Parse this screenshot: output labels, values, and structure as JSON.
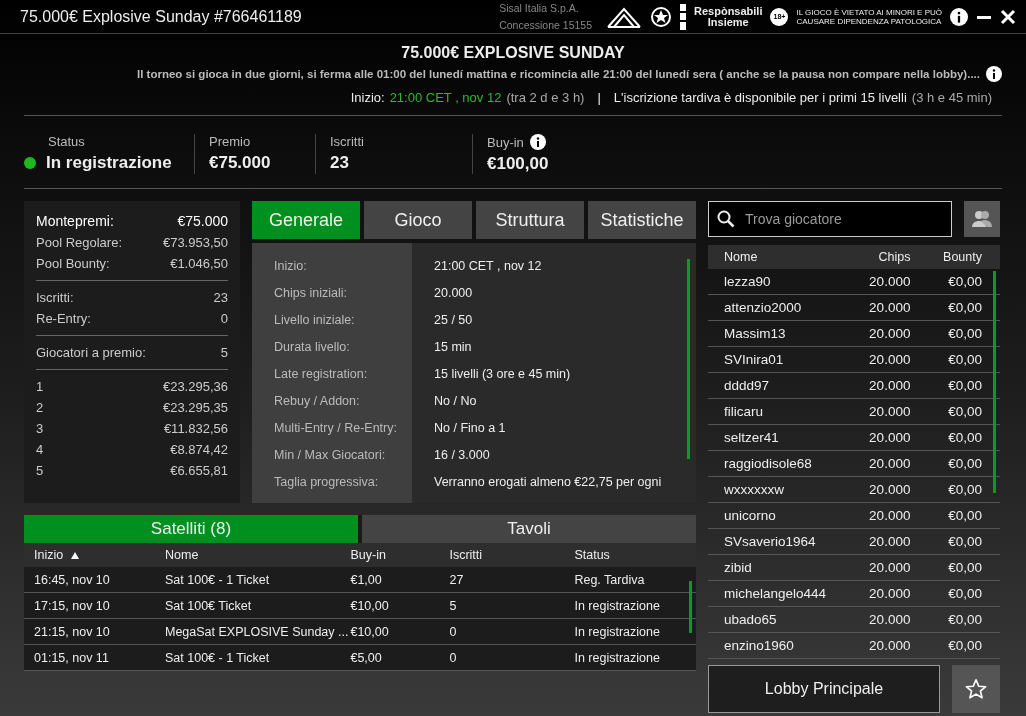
{
  "window": {
    "title": "75.000€ Explosive Sunday #766461189"
  },
  "header_logos": {
    "company": "Sisal Italia S.p.A.",
    "license": "Concessione 15155",
    "responsible": [
      "Respònsabili",
      "Insieme"
    ],
    "age_badge": "18+",
    "warning": [
      "IL GIOCO È VIETATO AI MINORI E PUÒ",
      "CAUSARE DIPENDENZA PATOLOGICA"
    ]
  },
  "tournament": {
    "name": "75.000€ EXPLOSIVE SUNDAY",
    "note": "Il torneo si gioca in due giorni, si ferma alle 01:00 del lunedí mattina e ricomincia alle 21:00 del lunedí sera ( anche se la pausa non compare nella lobby)....",
    "start_label": "Inizio:",
    "start_time": "21:00 CET , nov 12",
    "start_countdown": "(tra 2 d e 3 h)",
    "separator": "|",
    "late_reg": "L'iscrizione tardiva è disponibile per i primi 15 livelli",
    "late_reg_time": "(3 h e 45 min)"
  },
  "stats": [
    {
      "kind": "status",
      "label": "Status",
      "value": "In registrazione",
      "color": "#1db81d"
    },
    {
      "kind": "plain",
      "label": "Premio",
      "value": "€75.000"
    },
    {
      "kind": "plain",
      "label": "Iscritti",
      "value": "23"
    },
    {
      "kind": "info",
      "label": "Buy-in",
      "value": "€100,00"
    }
  ],
  "prize_summary": {
    "groups": [
      [
        {
          "label": "Montepremi:",
          "value": "€75.000"
        },
        {
          "label": "Pool Regolare:",
          "value": "€73.953,50"
        },
        {
          "label": "Pool Bounty:",
          "value": "€1.046,50"
        }
      ],
      [
        {
          "label": "Iscritti:",
          "value": "23"
        },
        {
          "label": "Re-Entry:",
          "value": "0"
        }
      ],
      [
        {
          "label": "Giocatori a premio:",
          "value": "5"
        }
      ],
      [
        {
          "label": "1",
          "value": "€23.295,36"
        },
        {
          "label": "2",
          "value": "€23.295,35"
        },
        {
          "label": "3",
          "value": "€11.832,56"
        },
        {
          "label": "4",
          "value": "€8.874,42"
        },
        {
          "label": "5",
          "value": "€6.655,81"
        }
      ]
    ]
  },
  "detail_tabs": [
    {
      "label": "Generale",
      "selected": true
    },
    {
      "label": "Gioco",
      "selected": false
    },
    {
      "label": "Struttura",
      "selected": false
    },
    {
      "label": "Statistiche",
      "selected": false
    }
  ],
  "details": [
    {
      "label": "Inizio:",
      "value": "21:00 CET , nov 12"
    },
    {
      "label": "Chips iniziali:",
      "value": "20.000"
    },
    {
      "label": "Livello iniziale:",
      "value": "25 / 50"
    },
    {
      "label": "Durata livello:",
      "value": "15 min"
    },
    {
      "label": "Late registration:",
      "value": "15 livelli (3 ore e 45 min)"
    },
    {
      "label": "Rebuy / Addon:",
      "value": "No / No"
    },
    {
      "label": "Multi-Entry / Re-Entry:",
      "value": "No / Fino a 1"
    },
    {
      "label": "Min / Max Giocatori:",
      "value": "16 / 3.000"
    },
    {
      "label": "Taglia progressiva:",
      "value": "Verranno erogati almeno €22,75 per ogni"
    }
  ],
  "players": {
    "search_placeholder": "Trova giocatore",
    "columns": [
      "Nome",
      "Chips",
      "Bounty"
    ],
    "rows": [
      [
        "lezza90",
        "20.000",
        "€0,00"
      ],
      [
        "attenzio2000",
        "20.000",
        "€0,00"
      ],
      [
        "Massim13",
        "20.000",
        "€0,00"
      ],
      [
        "SVInira01",
        "20.000",
        "€0,00"
      ],
      [
        "dddd97",
        "20.000",
        "€0,00"
      ],
      [
        "filicaru",
        "20.000",
        "€0,00"
      ],
      [
        "seltzer41",
        "20.000",
        "€0,00"
      ],
      [
        "raggiodisole68",
        "20.000",
        "€0,00"
      ],
      [
        "wxxxxxxw",
        "20.000",
        "€0,00"
      ],
      [
        "unicorno",
        "20.000",
        "€0,00"
      ],
      [
        "SVsaverio1964",
        "20.000",
        "€0,00"
      ],
      [
        "zibid",
        "20.000",
        "€0,00"
      ],
      [
        "michelangelo444",
        "20.000",
        "€0,00"
      ],
      [
        "ubado65",
        "20.000",
        "€0,00"
      ],
      [
        "enzino1960",
        "20.000",
        "€0,00"
      ]
    ]
  },
  "satellite_tabs": [
    {
      "label": "Satelliti (8)",
      "selected": true
    },
    {
      "label": "Tavoli",
      "selected": false
    }
  ],
  "satellites": {
    "columns": [
      "Inizio",
      "Nome",
      "Buy-in",
      "Iscritti",
      "Status"
    ],
    "rows": [
      [
        "16:45, nov 10",
        "Sat 100€ - 1 Ticket",
        "€1,00",
        "27",
        "Reg. Tardiva"
      ],
      [
        "17:15, nov 10",
        "Sat 100€ Ticket",
        "€10,00",
        "5",
        "In registrazione"
      ],
      [
        "21:15, nov 10",
        "MegaSat EXPLOSIVE Sunday ...",
        "€10,00",
        "0",
        "In registrazione"
      ],
      [
        "01:15, nov 11",
        "Sat 100€ - 1 Ticket",
        "€5,00",
        "0",
        "In registrazione"
      ]
    ]
  },
  "lobby_button": "Lobby Principale"
}
